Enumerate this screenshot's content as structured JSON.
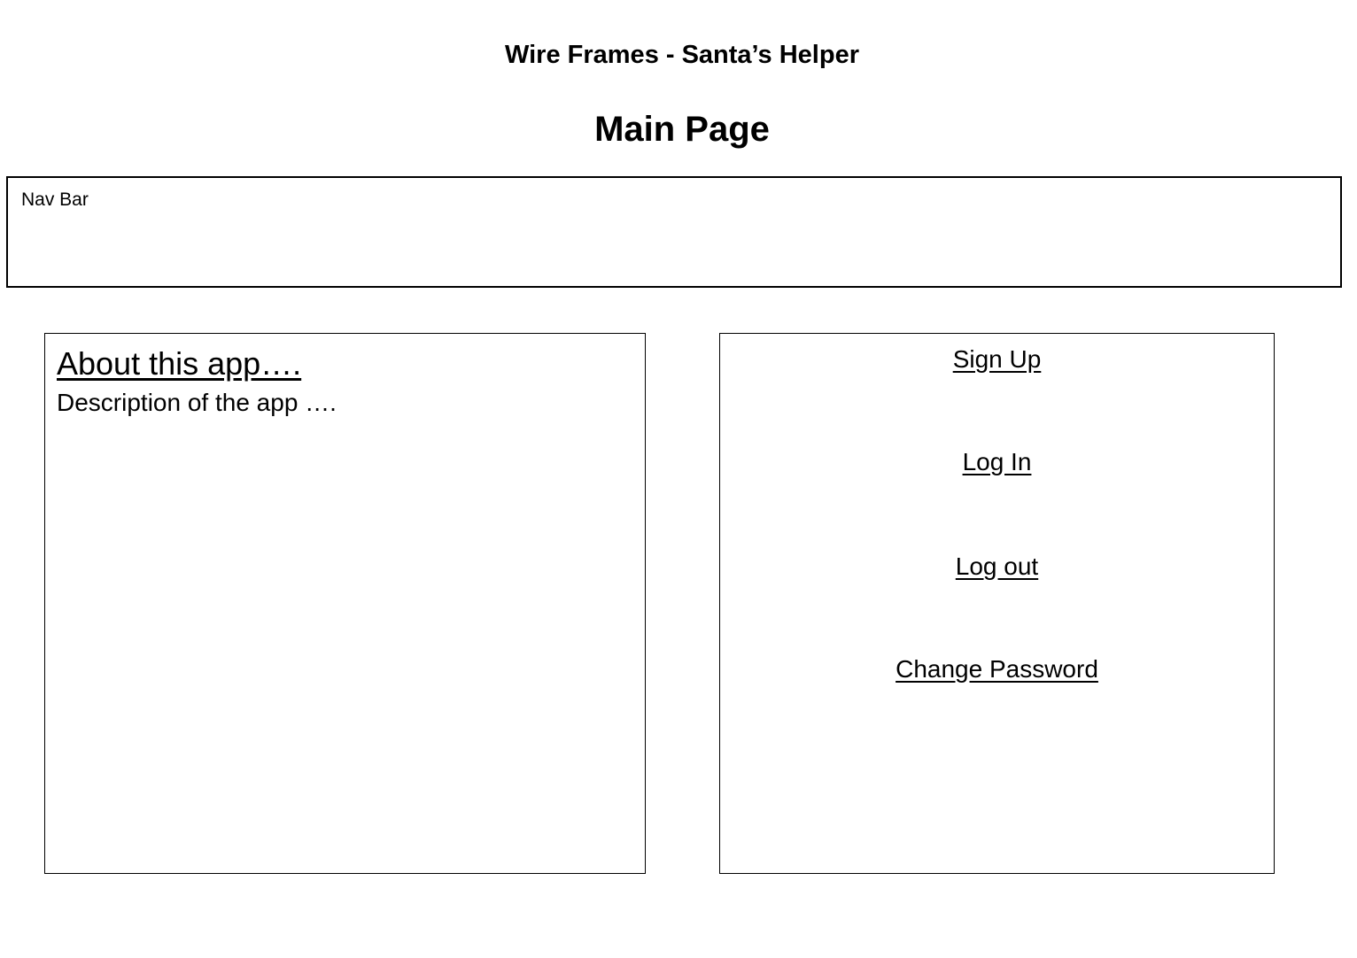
{
  "document": {
    "title": "Wire Frames - Santa’s Helper",
    "page_title": "Main Page"
  },
  "nav_bar": {
    "label": "Nav Bar"
  },
  "about": {
    "heading": "About this app….",
    "description": "Description of the app …."
  },
  "auth_links": {
    "sign_up": "Sign Up",
    "log_in": "Log In",
    "log_out": "Log out",
    "change_password": "Change Password"
  }
}
